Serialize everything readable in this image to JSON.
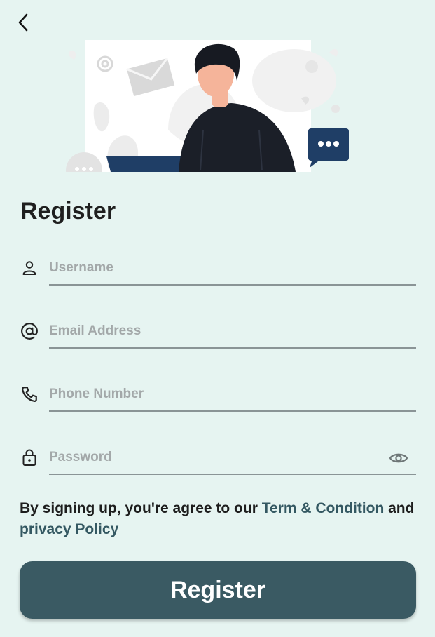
{
  "header": {
    "back_icon": "chevron-left-icon"
  },
  "form": {
    "title": "Register",
    "fields": [
      {
        "icon": "user-icon",
        "placeholder": "Username",
        "value": ""
      },
      {
        "icon": "at-sign-icon",
        "placeholder": "Email Address",
        "value": ""
      },
      {
        "icon": "phone-icon",
        "placeholder": "Phone Number",
        "value": ""
      },
      {
        "icon": "lock-icon",
        "placeholder": "Password",
        "value": ""
      }
    ],
    "password_toggle_icon": "eye-icon",
    "terms": {
      "prefix": "By signing up, you're agree to our ",
      "terms_link": "Term & Condition",
      "conjunction": " and ",
      "privacy_link": "privacy Policy"
    },
    "submit_label": "Register"
  },
  "colors": {
    "background": "#e6f4f1",
    "primary": "#3a5a63",
    "link": "#345862",
    "placeholder": "#a3a8a9"
  }
}
